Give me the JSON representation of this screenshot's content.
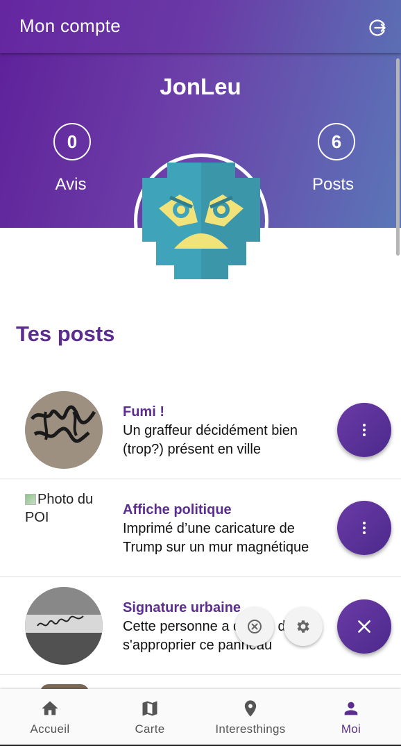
{
  "header": {
    "title": "Mon compte",
    "logout_icon": "logout-icon"
  },
  "profile": {
    "username": "JonLeu",
    "reviews_count": "0",
    "reviews_label": "Avis",
    "posts_count": "6",
    "posts_label": "Posts",
    "avatar_icon": "robot-avatar-icon"
  },
  "posts_section": {
    "title": "Tes posts"
  },
  "posts": [
    {
      "title": "Fumi !",
      "description": "Un graffeur décidément bien (trop?) présent en ville",
      "menu_icon": "more-vert-icon"
    },
    {
      "title": "Affiche politique",
      "description": "Imprimé d’une caricature de Trump sur un mur magnétique",
      "image_alt": "Photo du POI",
      "menu_icon": "more-vert-icon"
    },
    {
      "title": "Signature urbaine",
      "description": "Cette personne a décidé de s'approprier ce panneau",
      "menu_icon": "close-icon"
    }
  ],
  "nav": [
    {
      "label": "Accueil",
      "icon": "home-icon"
    },
    {
      "label": "Carte",
      "icon": "map-icon"
    },
    {
      "label": "Interesthings",
      "icon": "location-pin-icon"
    },
    {
      "label": "Moi",
      "icon": "person-icon",
      "active": true
    }
  ],
  "colors": {
    "primary": "#5b2d8e",
    "accent_gradient_end": "#5a76b8",
    "text": "#111111"
  }
}
